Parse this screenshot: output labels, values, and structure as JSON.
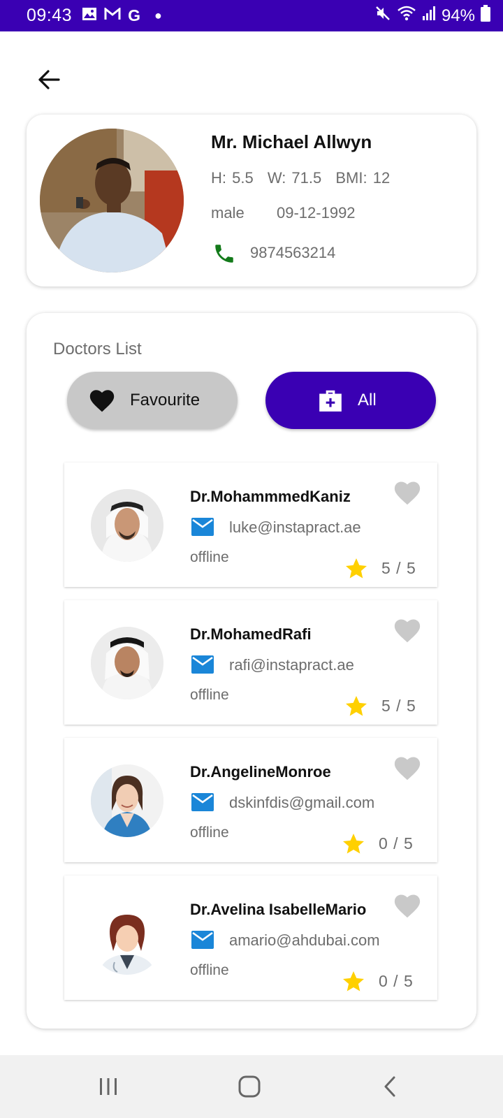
{
  "status_bar": {
    "time": "09:43",
    "left_icons": [
      "image-icon",
      "gmail-icon",
      "google-icon",
      "dot-icon"
    ],
    "battery_text": "94%",
    "right_icons": [
      "mute-icon",
      "wifi-icon",
      "signal-icon",
      "battery-icon"
    ]
  },
  "profile": {
    "name": "Mr. Michael Allwyn",
    "height": "H: 5.5",
    "weight": "W: 71.5",
    "bmi": "BMI: 12",
    "gender": "male",
    "dob": "09-12-1992",
    "phone": "9874563214"
  },
  "doctors": {
    "title": "Doctors List",
    "favourite_label": "Favourite",
    "all_label": "All",
    "list": [
      {
        "name": "Dr.MohammmedKaniz",
        "email": "luke@instapract.ae",
        "status": "offline",
        "rating": "5 / 5"
      },
      {
        "name": "Dr.MohamedRafi",
        "email": "rafi@instapract.ae",
        "status": "offline",
        "rating": "5 / 5"
      },
      {
        "name": "Dr.AngelineMonroe",
        "email": "dskinfdis@gmail.com",
        "status": "offline",
        "rating": "0 / 5"
      },
      {
        "name": "Dr.Avelina IsabelleMario",
        "email": "amario@ahdubai.com",
        "status": "offline",
        "rating": "0 / 5"
      }
    ]
  },
  "colors": {
    "primary": "#3a00b3",
    "star": "#ffd000",
    "heart_inactive": "#c9c9c9",
    "mail_icon": "#1a86d8",
    "phone_icon": "#137a1a"
  }
}
